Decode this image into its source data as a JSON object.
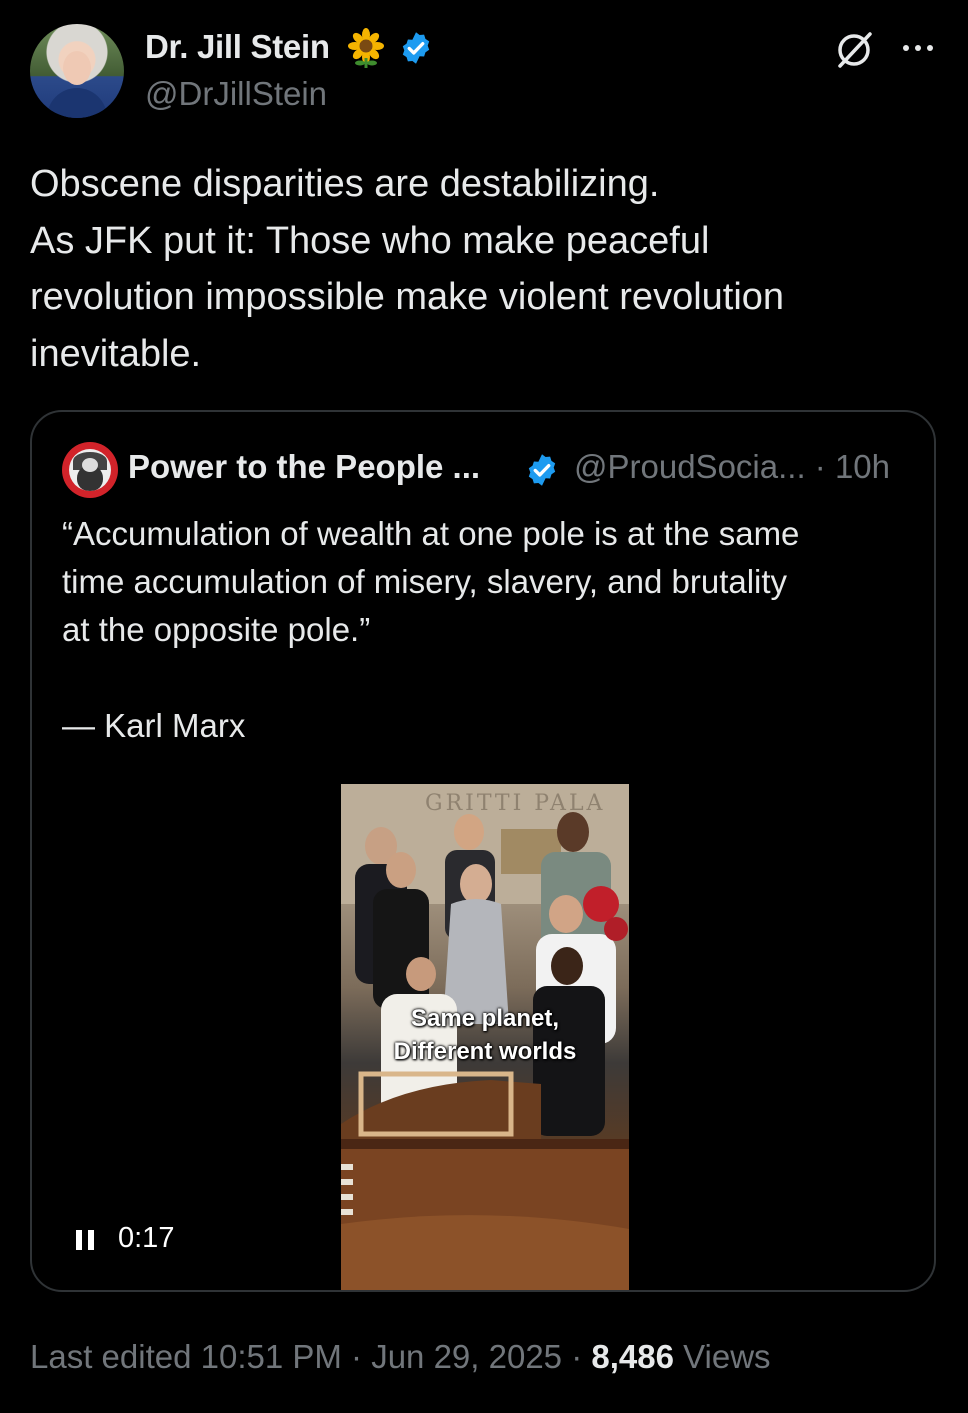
{
  "author": {
    "name": "Dr. Jill Stein",
    "handle": "@DrJillStein",
    "emoji_icon": "sunflower-icon",
    "verified_icon": "verified-badge-icon"
  },
  "tweet": {
    "lines": [
      "Obscene disparities are destabilizing.",
      "As JFK put it: Those who make peaceful",
      "revolution impossible make violent revolution",
      "inevitable."
    ]
  },
  "quoted_tweet": {
    "name": "Power to the People ...",
    "handle_time": "@ProudSocia... · 10h",
    "quote_lines": [
      "“Accumulation of wealth at one pole is at the same",
      "time accumulation of misery, slavery, and brutality",
      "at the opposite pole.”"
    ],
    "attribution": "— Karl Marx",
    "video": {
      "caption_line1": "Same planet,",
      "caption_line2": "Different worlds",
      "sign_text": "GRITTI PALA",
      "duration": "0:17"
    }
  },
  "footer": {
    "edited": "Last edited 10:51 PM · Jun 29, 2025 · ",
    "views_count": "8,486",
    "views_label": " Views"
  },
  "colors": {
    "background": "#000000",
    "text_primary": "#e7e9ea",
    "text_secondary": "#71767b",
    "verified_blue": "#1d9bf0",
    "border": "#2f3336"
  }
}
